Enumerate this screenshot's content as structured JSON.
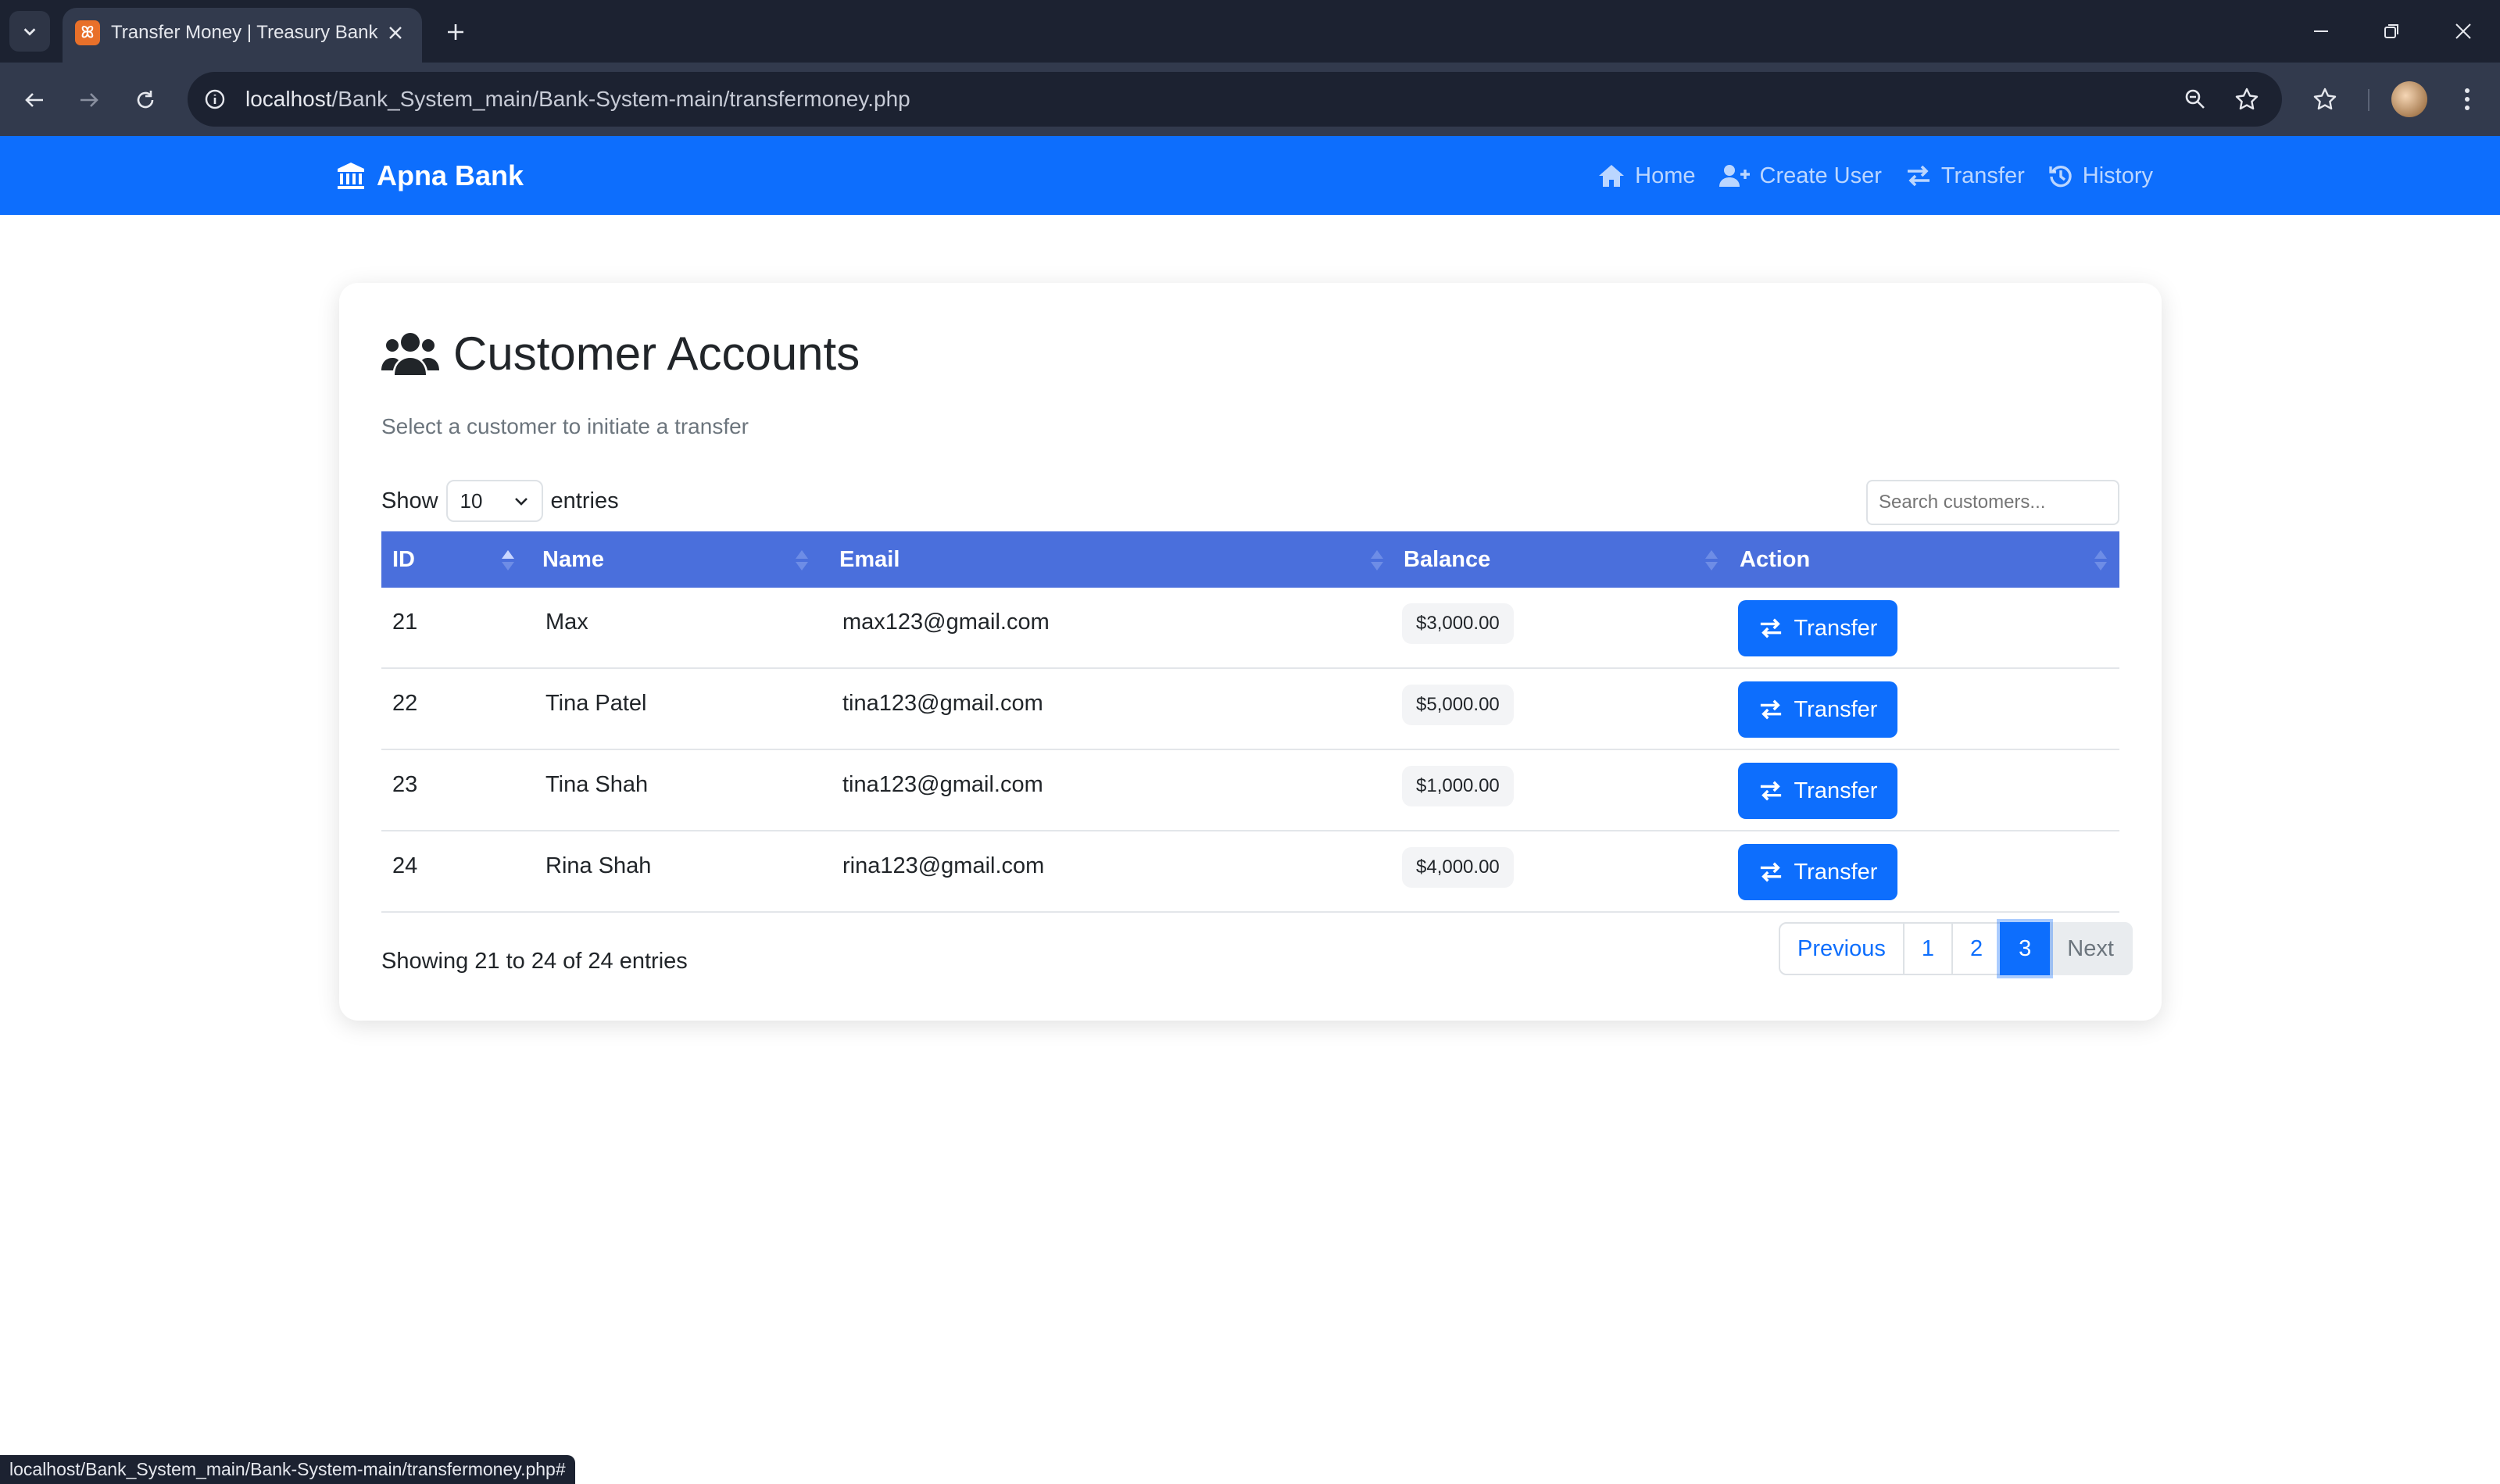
{
  "browser": {
    "tab_title": "Transfer Money | Treasury Bank",
    "tab_favicon_glyph": "ꕤ",
    "url_host": "localhost",
    "url_path": "/Bank_System_main/Bank-System-main/transfermoney.php",
    "status_url": "localhost/Bank_System_main/Bank-System-main/transfermoney.php#"
  },
  "navbar": {
    "brand": "Apna Bank",
    "links": [
      {
        "label": "Home",
        "icon": "home-icon"
      },
      {
        "label": "Create User",
        "icon": "user-plus-icon"
      },
      {
        "label": "Transfer",
        "icon": "exchange-icon"
      },
      {
        "label": "History",
        "icon": "history-icon"
      }
    ]
  },
  "card": {
    "title": "Customer Accounts",
    "subtitle": "Select a customer to initiate a transfer"
  },
  "table_controls": {
    "show_label": "Show",
    "entries_value": "10",
    "entries_label": "entries",
    "search_placeholder": "Search customers..."
  },
  "table": {
    "columns": [
      "ID",
      "Name",
      "Email",
      "Balance",
      "Action"
    ],
    "rows": [
      {
        "id": "21",
        "name": "Max",
        "email": "max123@gmail.com",
        "balance": "$3,000.00",
        "action": "Transfer"
      },
      {
        "id": "22",
        "name": "Tina Patel",
        "email": "tina123@gmail.com",
        "balance": "$5,000.00",
        "action": "Transfer"
      },
      {
        "id": "23",
        "name": "Tina Shah",
        "email": "tina123@gmail.com",
        "balance": "$1,000.00",
        "action": "Transfer"
      },
      {
        "id": "24",
        "name": "Rina Shah",
        "email": "rina123@gmail.com",
        "balance": "$4,000.00",
        "action": "Transfer"
      }
    ]
  },
  "footer": {
    "info": "Showing 21 to 24 of 24 entries",
    "pagination": {
      "previous": "Previous",
      "pages": [
        "1",
        "2",
        "3"
      ],
      "active_page": "3",
      "next": "Next"
    }
  },
  "colors": {
    "primary": "#0d6efd",
    "table_header": "#4a6fdc",
    "browser_dark": "#1c2231"
  }
}
